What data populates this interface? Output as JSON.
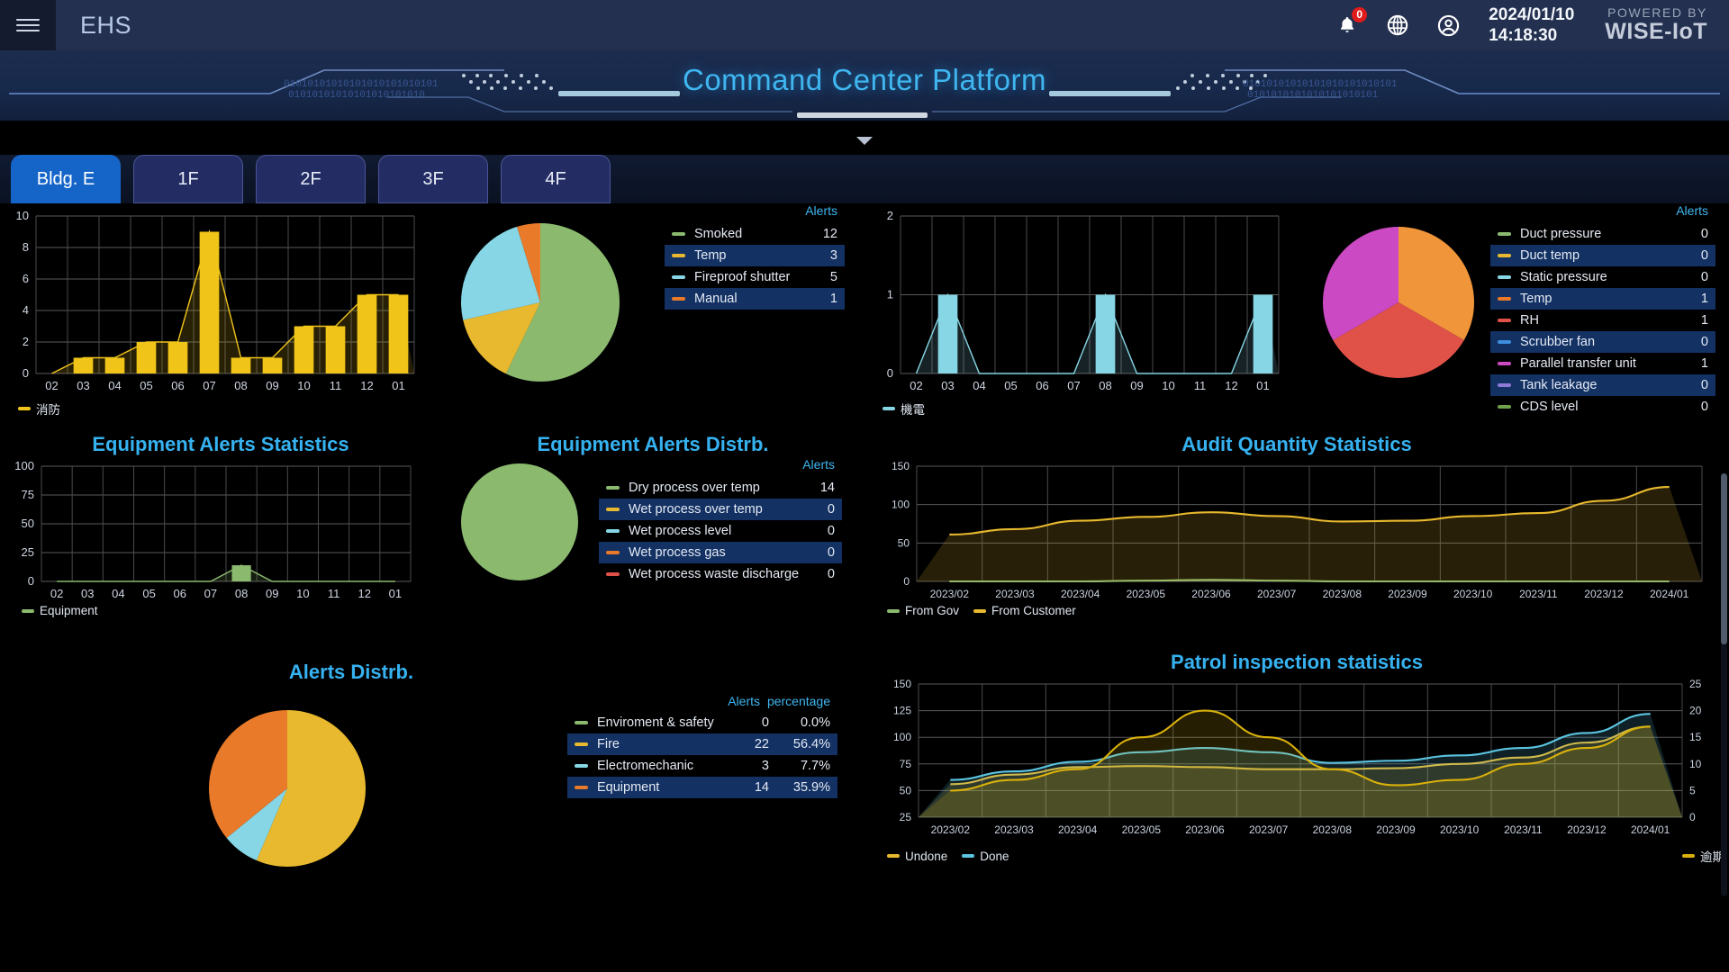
{
  "header": {
    "brand": "EHS",
    "menu_icon": "hamburger-icon",
    "notification_count": "0",
    "date": "2024/01/10",
    "time": "14:18:30",
    "powered_by": "POWERED BY",
    "vendor": "WISE-IoT"
  },
  "banner": {
    "title": "Command Center Platform"
  },
  "tabs": [
    {
      "label": "Bldg. E",
      "active": true
    },
    {
      "label": "1F",
      "active": false
    },
    {
      "label": "2F",
      "active": false
    },
    {
      "label": "3F",
      "active": false
    },
    {
      "label": "4F",
      "active": false
    }
  ],
  "colors": {
    "accent": "#36b2f0",
    "green": "#8bba6f",
    "yellow": "#e8b92e",
    "cyan": "#86d6e5",
    "orange": "#e87a2a",
    "red": "#e05248",
    "blue": "#3d8ede",
    "magenta": "#cc49c4",
    "purple": "#8d7ad6",
    "gold": "#f0c419",
    "row_highlight": "#133163",
    "tab_active": "#1565c8"
  },
  "panels": {
    "fire": {
      "legend_header": "Alerts",
      "legend": [
        {
          "label": "Smoked",
          "value": "12",
          "color": "#8bba6f"
        },
        {
          "label": "Temp",
          "value": "3",
          "color": "#e8b92e"
        },
        {
          "label": "Fireproof shutter",
          "value": "5",
          "color": "#86d6e5"
        },
        {
          "label": "Manual",
          "value": "1",
          "color": "#e87a2a"
        }
      ]
    },
    "electromechanic": {
      "legend_header": "Alerts",
      "legend": [
        {
          "label": "Duct pressure",
          "value": "0",
          "color": "#8bba6f"
        },
        {
          "label": "Duct temp",
          "value": "0",
          "color": "#e8b92e"
        },
        {
          "label": "Static pressure",
          "value": "0",
          "color": "#86d6e5"
        },
        {
          "label": "Temp",
          "value": "1",
          "color": "#e87a2a"
        },
        {
          "label": "RH",
          "value": "1",
          "color": "#e05248"
        },
        {
          "label": "Scrubber fan",
          "value": "0",
          "color": "#3d8ede"
        },
        {
          "label": "Parallel transfer unit",
          "value": "1",
          "color": "#cc49c4"
        },
        {
          "label": "Tank leakage",
          "value": "0",
          "color": "#8d7ad6"
        },
        {
          "label": "CDS level",
          "value": "0",
          "color": "#6fa24a"
        }
      ]
    },
    "equipment_distrb": {
      "title": "Equipment Alerts Distrb.",
      "legend_header": "Alerts",
      "legend": [
        {
          "label": "Dry process over temp",
          "value": "14",
          "color": "#8bba6f"
        },
        {
          "label": "Wet process over temp",
          "value": "0",
          "color": "#e8b92e"
        },
        {
          "label": "Wet process level",
          "value": "0",
          "color": "#86d6e5"
        },
        {
          "label": "Wet process gas",
          "value": "0",
          "color": "#e87a2a"
        },
        {
          "label": "Wet process waste discharge",
          "value": "0",
          "color": "#e05248"
        }
      ]
    },
    "alerts_distrb": {
      "title": "Alerts Distrb.",
      "header_alerts": "Alerts",
      "header_percentage": "percentage",
      "rows": [
        {
          "label": "Enviroment & safety",
          "alerts": "0",
          "percentage": "0.0%",
          "color": "#8bba6f"
        },
        {
          "label": "Fire",
          "alerts": "22",
          "percentage": "56.4%",
          "color": "#e8b92e"
        },
        {
          "label": "Electromechanic",
          "alerts": "3",
          "percentage": "7.7%",
          "color": "#86d6e5"
        },
        {
          "label": "Equipment",
          "alerts": "14",
          "percentage": "35.9%",
          "color": "#e87a2a"
        }
      ]
    }
  },
  "chart_data": [
    {
      "id": "fire_stats",
      "type": "bar",
      "title": "",
      "categories": [
        "02",
        "03",
        "04",
        "05",
        "06",
        "07",
        "08",
        "09",
        "10",
        "11",
        "12",
        "01"
      ],
      "series": [
        {
          "name": "消防",
          "values": [
            0,
            1,
            1,
            2,
            2,
            9,
            1,
            1,
            3,
            3,
            5,
            5
          ],
          "color": "#f0c419"
        }
      ],
      "ylim": [
        0,
        10
      ],
      "yticks": [
        0,
        2,
        4,
        6,
        8,
        10
      ],
      "legend": [
        "消防"
      ],
      "legend_position": "bottom-left",
      "grid": true
    },
    {
      "id": "fire_pie",
      "type": "pie",
      "title": "",
      "labels": [
        "Smoked",
        "Temp",
        "Fireproof shutter",
        "Manual"
      ],
      "values": [
        12,
        3,
        5,
        1
      ],
      "colors": [
        "#8bba6f",
        "#e8b92e",
        "#86d6e5",
        "#e87a2a"
      ],
      "legend_position": "right"
    },
    {
      "id": "electromechanic_stats",
      "type": "bar",
      "title": "",
      "categories": [
        "02",
        "03",
        "04",
        "05",
        "06",
        "07",
        "08",
        "09",
        "10",
        "11",
        "12",
        "01"
      ],
      "series": [
        {
          "name": "機電",
          "values": [
            0,
            1,
            0,
            0,
            0,
            0,
            1,
            0,
            0,
            0,
            0,
            1
          ],
          "color": "#86d6e5"
        }
      ],
      "ylim": [
        0,
        2
      ],
      "yticks": [
        0,
        1,
        2
      ],
      "legend": [
        "機電"
      ],
      "legend_position": "bottom-left",
      "grid": true
    },
    {
      "id": "electromechanic_pie",
      "type": "pie",
      "title": "",
      "labels": [
        "Temp",
        "RH",
        "Parallel transfer unit"
      ],
      "values": [
        1,
        1,
        1
      ],
      "colors": [
        "#f0953a",
        "#e05248",
        "#cc49c4"
      ],
      "legend_position": "right"
    },
    {
      "id": "equipment_alerts_statistics",
      "type": "bar",
      "title": "Equipment Alerts Statistics",
      "categories": [
        "02",
        "03",
        "04",
        "05",
        "06",
        "07",
        "08",
        "09",
        "10",
        "11",
        "12",
        "01"
      ],
      "series": [
        {
          "name": "Equipment",
          "values": [
            0,
            0,
            0,
            0,
            0,
            0,
            14,
            0,
            0,
            0,
            0,
            0
          ],
          "color": "#8bba6f"
        }
      ],
      "ylim": [
        0,
        100
      ],
      "yticks": [
        0,
        25,
        50,
        75,
        100
      ],
      "legend": [
        "Equipment"
      ],
      "legend_position": "bottom-left",
      "grid": true
    },
    {
      "id": "equipment_alerts_distrb_pie",
      "type": "pie",
      "title": "Equipment Alerts Distrb.",
      "labels": [
        "Dry process over temp",
        "Wet process over temp",
        "Wet process level",
        "Wet process gas",
        "Wet process waste discharge"
      ],
      "values": [
        14,
        0,
        0,
        0,
        0
      ],
      "colors": [
        "#8bba6f",
        "#e8b92e",
        "#86d6e5",
        "#e87a2a",
        "#e05248"
      ],
      "legend_position": "right"
    },
    {
      "id": "alerts_distrb_pie",
      "type": "pie",
      "title": "Alerts Distrb.",
      "labels": [
        "Enviroment & safety",
        "Fire",
        "Electromechanic",
        "Equipment"
      ],
      "values": [
        0,
        22,
        3,
        14
      ],
      "percentages": [
        "0.0%",
        "56.4%",
        "7.7%",
        "35.9%"
      ],
      "colors": [
        "#8bba6f",
        "#e8b92e",
        "#86d6e5",
        "#e87a2a"
      ],
      "legend_position": "right"
    },
    {
      "id": "audit_quantity_statistics",
      "type": "area",
      "title": "Audit Quantity Statistics",
      "categories": [
        "2023/02",
        "2023/03",
        "2023/04",
        "2023/05",
        "2023/06",
        "2023/07",
        "2023/08",
        "2023/09",
        "2023/10",
        "2023/11",
        "2023/12",
        "2024/01"
      ],
      "series": [
        {
          "name": "From Gov",
          "values": [
            0,
            0,
            0,
            1,
            2,
            1,
            0,
            0,
            0,
            0,
            0,
            0
          ],
          "color": "#8bba6f"
        },
        {
          "name": "From Customer",
          "values": [
            61,
            68,
            79,
            84,
            90,
            85,
            78,
            79,
            85,
            89,
            105,
            123
          ],
          "color": "#e8b92e"
        }
      ],
      "ylim": [
        0,
        150
      ],
      "yticks": [
        0,
        50,
        100,
        150
      ],
      "legend": [
        "From Gov",
        "From Customer"
      ],
      "legend_position": "bottom-left",
      "grid": true
    },
    {
      "id": "patrol_inspection_statistics",
      "type": "area",
      "title": "Patrol inspection statistics",
      "categories": [
        "2023/02",
        "2023/03",
        "2023/04",
        "2023/05",
        "2023/06",
        "2023/07",
        "2023/08",
        "2023/09",
        "2023/10",
        "2023/11",
        "2023/12",
        "2024/01"
      ],
      "series": [
        {
          "name": "Undone",
          "values": [
            56,
            65,
            72,
            73,
            72,
            70,
            70,
            71,
            75,
            81,
            95,
            110
          ],
          "color": "#e8b92e",
          "axis": "left"
        },
        {
          "name": "Done",
          "values": [
            60,
            68,
            77,
            86,
            90,
            86,
            76,
            78,
            83,
            90,
            104,
            122
          ],
          "color": "#5bc4e0",
          "axis": "left"
        },
        {
          "name": "逾期",
          "values": [
            5,
            7,
            9,
            15,
            20,
            15,
            9,
            6,
            7,
            10,
            13,
            17
          ],
          "color": "#d9b00c",
          "axis": "right"
        }
      ],
      "ylim": [
        25,
        150
      ],
      "yticks": [
        25,
        50,
        75,
        100,
        125,
        150
      ],
      "y2lim": [
        0,
        25
      ],
      "y2ticks": [
        0,
        5,
        10,
        15,
        20,
        25
      ],
      "legend": [
        "Undone",
        "Done",
        "逾期"
      ],
      "legend_position": "bottom",
      "grid": true
    }
  ]
}
